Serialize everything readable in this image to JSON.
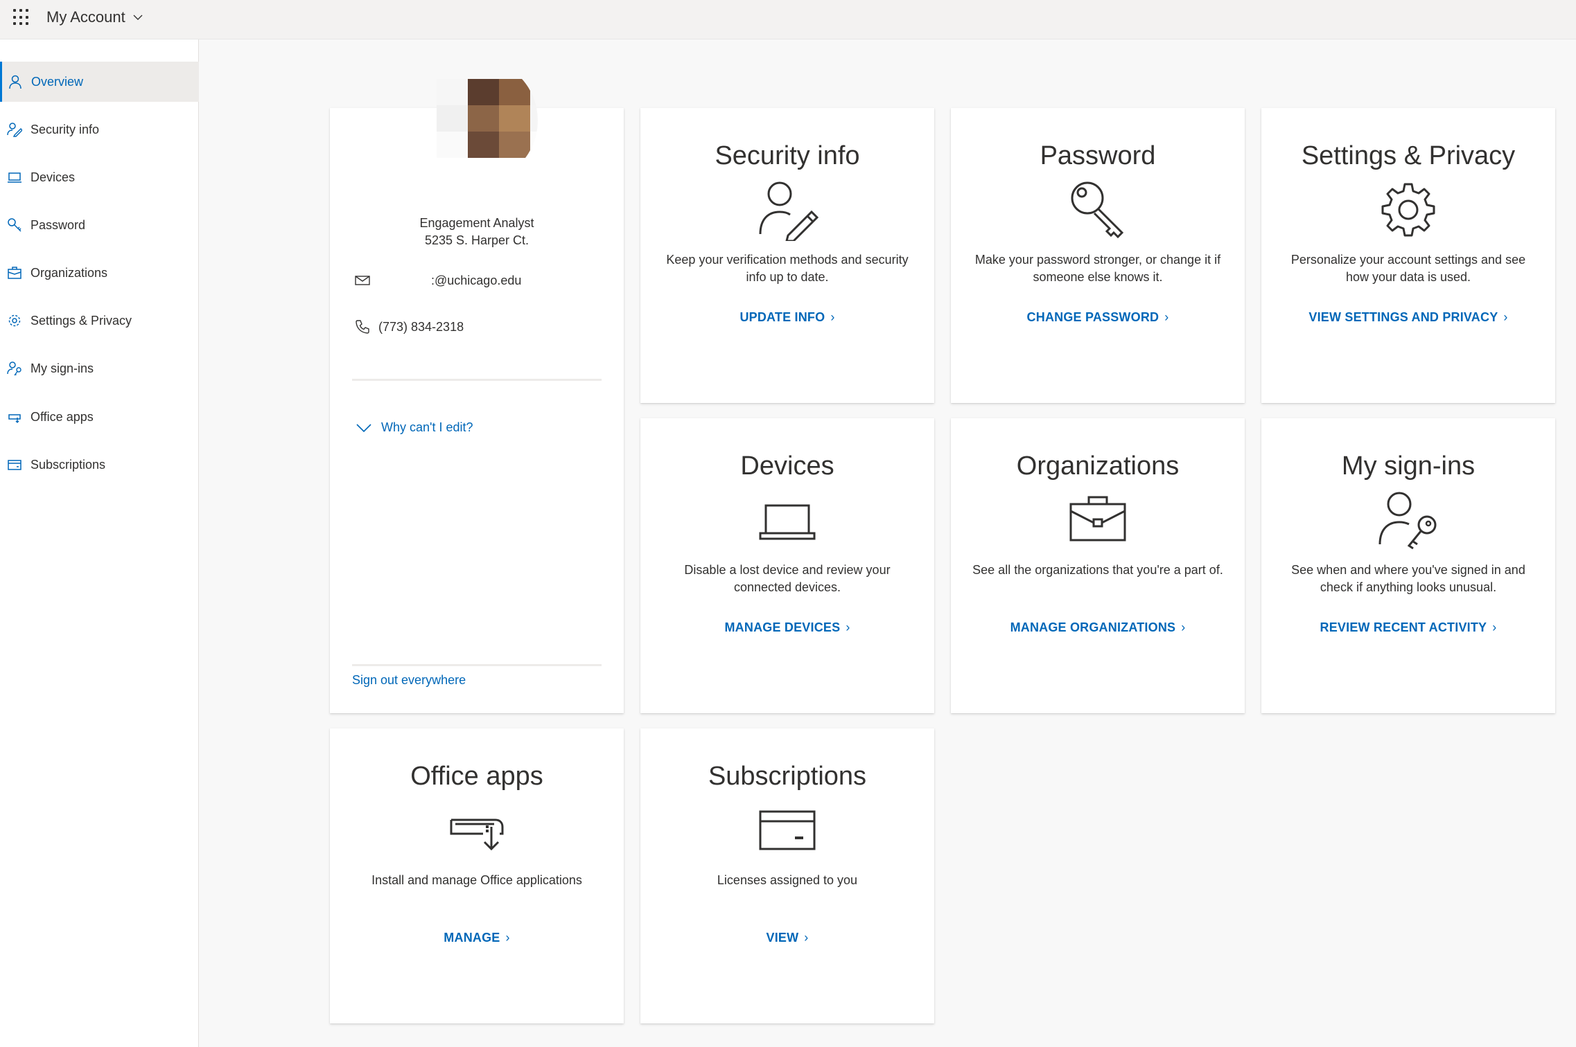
{
  "header": {
    "title": "My Account",
    "waffle_icon": "app-launcher-icon"
  },
  "sidebar": {
    "items": [
      {
        "label": "Overview",
        "icon": "person-icon",
        "active": true
      },
      {
        "label": "Security info",
        "icon": "person-edit-icon"
      },
      {
        "label": "Devices",
        "icon": "laptop-icon"
      },
      {
        "label": "Password",
        "icon": "key-icon"
      },
      {
        "label": "Organizations",
        "icon": "briefcase-icon"
      },
      {
        "label": "Settings & Privacy",
        "icon": "gear-icon"
      },
      {
        "label": "My sign-ins",
        "icon": "person-key-icon"
      },
      {
        "label": "Office apps",
        "icon": "office-apps-icon"
      },
      {
        "label": "Subscriptions",
        "icon": "card-icon"
      }
    ]
  },
  "profile": {
    "job_title": "Engagement Analyst",
    "address": "5235 S. Harper Ct.",
    "email": ":@uchicago.edu",
    "phone": "(773) 834-2318",
    "why_cant_edit": "Why can't I edit?",
    "sign_out": "Sign out everywhere"
  },
  "tiles": [
    {
      "title": "Security info",
      "icon": "person-edit-icon",
      "description": "Keep your verification methods and security info up to date.",
      "link": "UPDATE INFO"
    },
    {
      "title": "Password",
      "icon": "key-icon",
      "description": "Make your password stronger, or change it if someone else knows it.",
      "link": "CHANGE PASSWORD"
    },
    {
      "title": "Settings & Privacy",
      "icon": "gear-icon",
      "description": "Personalize your account settings and see how your data is used.",
      "link": "VIEW SETTINGS AND PRIVACY"
    },
    {
      "title": "Devices",
      "icon": "laptop-icon",
      "description": "Disable a lost device and review your connected devices.",
      "link": "MANAGE DEVICES"
    },
    {
      "title": "Organizations",
      "icon": "briefcase-icon",
      "description": "See all the organizations that you're a part of.",
      "link": "MANAGE ORGANIZATIONS"
    },
    {
      "title": "My sign-ins",
      "icon": "person-key-icon",
      "description": "See when and where you've signed in and check if anything looks unusual.",
      "link": "REVIEW RECENT ACTIVITY"
    },
    {
      "title": "Office apps",
      "icon": "office-apps-icon",
      "description": "Install and manage Office applications",
      "link": "MANAGE"
    },
    {
      "title": "Subscriptions",
      "icon": "card-icon",
      "description": "Licenses assigned to you",
      "link": "VIEW"
    }
  ],
  "colors": {
    "accent": "#0067b8",
    "active_border": "#0078d4",
    "background": "#f8f8f8"
  }
}
